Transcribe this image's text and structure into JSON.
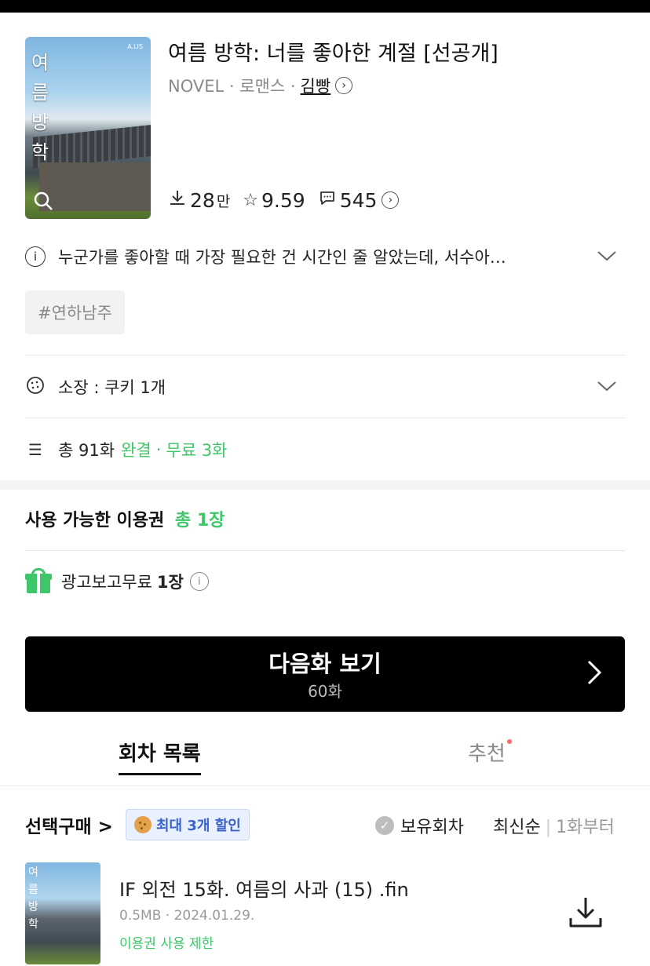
{
  "book": {
    "title": "여름 방학: 너를 좋아한 계절 [선공개]",
    "category": "NOVEL · 로맨스 ·",
    "author": "김빵",
    "cover_text": "여름방학",
    "cover_brand": "A.LIS",
    "downloads": "28",
    "downloads_unit": "만",
    "rating": "9.59",
    "comments": "545"
  },
  "description": "누군가를 좋아할 때 가장 필요한 건 시간인 줄 알았는데, 서수아…",
  "tags": [
    "#연하남주"
  ],
  "ownership": {
    "label": "소장 : 쿠키 1개"
  },
  "episodes_summary": {
    "total": "총 91화",
    "status": "완결",
    "dot": "·",
    "free": "무료 3화"
  },
  "tickets": {
    "heading": "사용 가능한 이용권",
    "total": "총 1장",
    "ad_label": "광고보고무료",
    "ad_count": "1장"
  },
  "next_button": {
    "label": "다음화 보기",
    "episode": "60화"
  },
  "tabs": [
    {
      "label": "회차 목록",
      "active": true
    },
    {
      "label": "추천",
      "active": false
    }
  ],
  "list_controls": {
    "select_buy": "선택구매 >",
    "discount_badge": "최대 3개 할인",
    "owned": "보유회차",
    "sort_latest": "최신순",
    "sort_first": "1화부터"
  },
  "episodes": [
    {
      "title": "IF 외전 15화. 여름의 사과 (15) .fin",
      "meta": "0.5MB · 2024.01.29.",
      "limit": "이용권 사용 제한",
      "thumb_text": "여름방학"
    }
  ],
  "icons": {
    "info": "info-icon",
    "cookie": "cookie-icon",
    "list": "list-icon",
    "gift": "gift-icon",
    "download": "download-icon"
  },
  "colors": {
    "accent_green": "#3fc66a",
    "button_bg": "#000000",
    "badge_blue": "#3a62c8"
  }
}
